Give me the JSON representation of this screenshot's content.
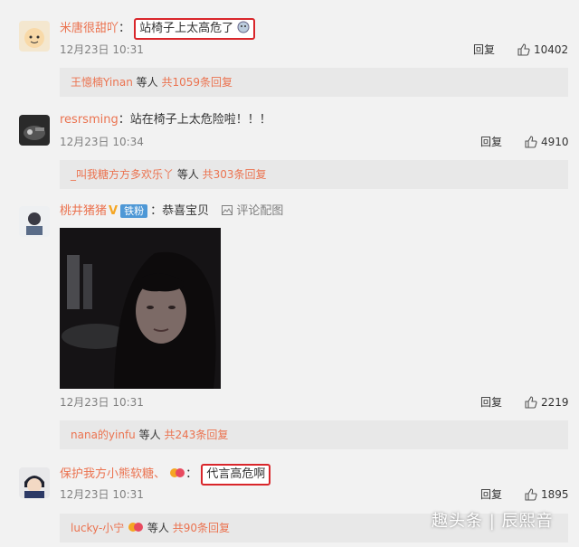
{
  "comments": [
    {
      "username": "米唐很甜吖",
      "sep": "：",
      "text": "站椅子上太高危了",
      "time": "12月23日 10:31",
      "reply_label": "回复",
      "likes": "10402",
      "sub_user": "王憶楠Yinan",
      "sub_mid": " 等人 ",
      "sub_count": "共1059条回复"
    },
    {
      "username": "resrsming",
      "sep": "：",
      "text": "站在椅子上太危险啦！！！",
      "time": "12月23日 10:34",
      "reply_label": "回复",
      "likes": "4910",
      "sub_user": "_叫我糖方方多欢乐丫",
      "sub_mid": " 等人 ",
      "sub_count": "共303条回复"
    },
    {
      "username": "桃井猪猪",
      "badge": "铁粉",
      "sep": "：",
      "text": "恭喜宝贝",
      "pic_comment": "评论配图",
      "time": "12月23日 10:31",
      "reply_label": "回复",
      "likes": "2219",
      "sub_user": "nana的yinfu",
      "sub_mid": " 等人 ",
      "sub_count": "共243条回复"
    },
    {
      "username": "保护我方小熊软糖、",
      "sep": "：",
      "text": "代言高危啊",
      "time": "12月23日 10:31",
      "reply_label": "回复",
      "likes": "1895",
      "sub_user": "lucky-小宁",
      "sub_mid": " 等人 ",
      "sub_count": "共90条回复"
    }
  ],
  "watermark": "趣头条 | 辰熙音",
  "colors": {
    "username": "#eb7350",
    "highlight_box": "#d9262b",
    "badge": "#4e98d6"
  }
}
